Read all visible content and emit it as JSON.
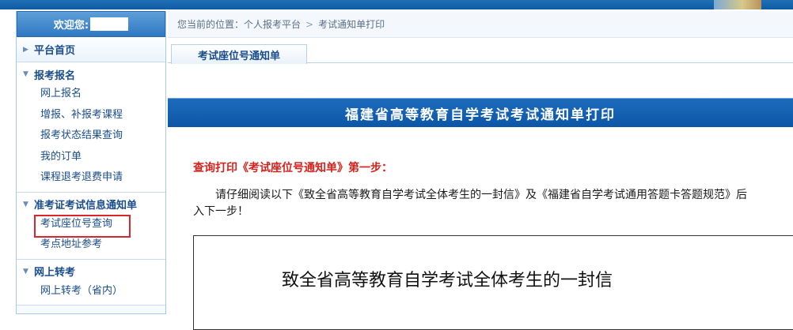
{
  "colors": {
    "accent": "#0d56a6",
    "nav_text": "#1a4d8a",
    "warning_text": "#d4221c",
    "highlight_border": "#d9262c"
  },
  "sidebar": {
    "welcome": "欢迎您:",
    "home": "平台首页",
    "groups": [
      {
        "title": "报考报名",
        "items": [
          "网上报名",
          "增报、补报考课程",
          "报考状态结果查询",
          "我的订单",
          "课程退考退费申请"
        ]
      },
      {
        "title": "准考证考试信息通知单",
        "items": [
          "考试座位号查询",
          "考点地址参考"
        ]
      },
      {
        "title": "网上转考",
        "items": [
          "网上转考（省内）"
        ]
      }
    ]
  },
  "breadcrumb": {
    "prefix": "您当前的位置：",
    "level1": "个人报考平台",
    "separator": ">",
    "level2": "考试通知单打印"
  },
  "tab": {
    "label": "考试座位号通知单"
  },
  "banner": {
    "title": "福建省高等教育自学考试考试通知单打印"
  },
  "step": {
    "text": "查询打印《考试座位号通知单》第一步："
  },
  "intro": {
    "line1": "请仔细阅读以下《致全省高等教育自学考试全体考生的一封信》及《福建省自学考试通用答题卡答题规范》后",
    "line2": "入下一步！"
  },
  "letter": {
    "title": "致全省高等教育自学考试全体考生的一封信"
  }
}
